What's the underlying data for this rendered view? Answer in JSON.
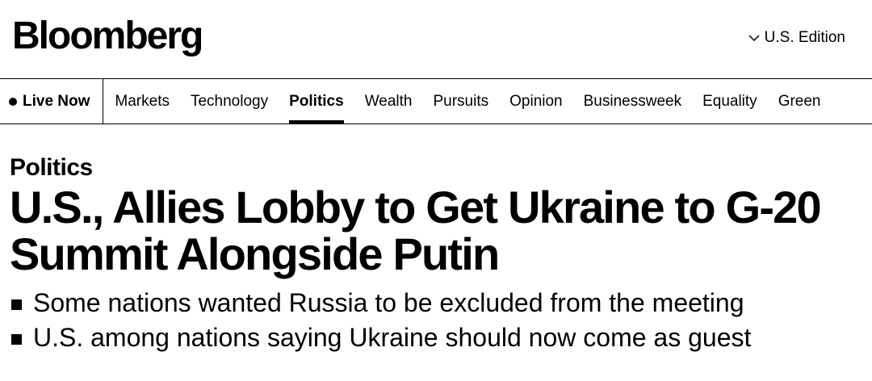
{
  "header": {
    "logo": "Bloomberg",
    "edition": "U.S. Edition"
  },
  "nav": {
    "live_label": "Live Now",
    "items": [
      {
        "label": "Markets",
        "active": false
      },
      {
        "label": "Technology",
        "active": false
      },
      {
        "label": "Politics",
        "active": true
      },
      {
        "label": "Wealth",
        "active": false
      },
      {
        "label": "Pursuits",
        "active": false
      },
      {
        "label": "Opinion",
        "active": false
      },
      {
        "label": "Businessweek",
        "active": false
      },
      {
        "label": "Equality",
        "active": false
      },
      {
        "label": "Green",
        "active": false
      }
    ]
  },
  "article": {
    "kicker": "Politics",
    "headline": "U.S., Allies Lobby to Get Ukraine to G-20 Summit Alongside Putin",
    "bullets": [
      "Some nations wanted Russia to be excluded from the meeting",
      "U.S. among nations saying Ukraine should now come as guest"
    ]
  },
  "icons": {
    "edition": "chevron-down-icon",
    "live": "live-dot-icon",
    "bullet": "square-bullet-icon"
  },
  "colors": {
    "text": "#000000",
    "background": "#ffffff"
  }
}
